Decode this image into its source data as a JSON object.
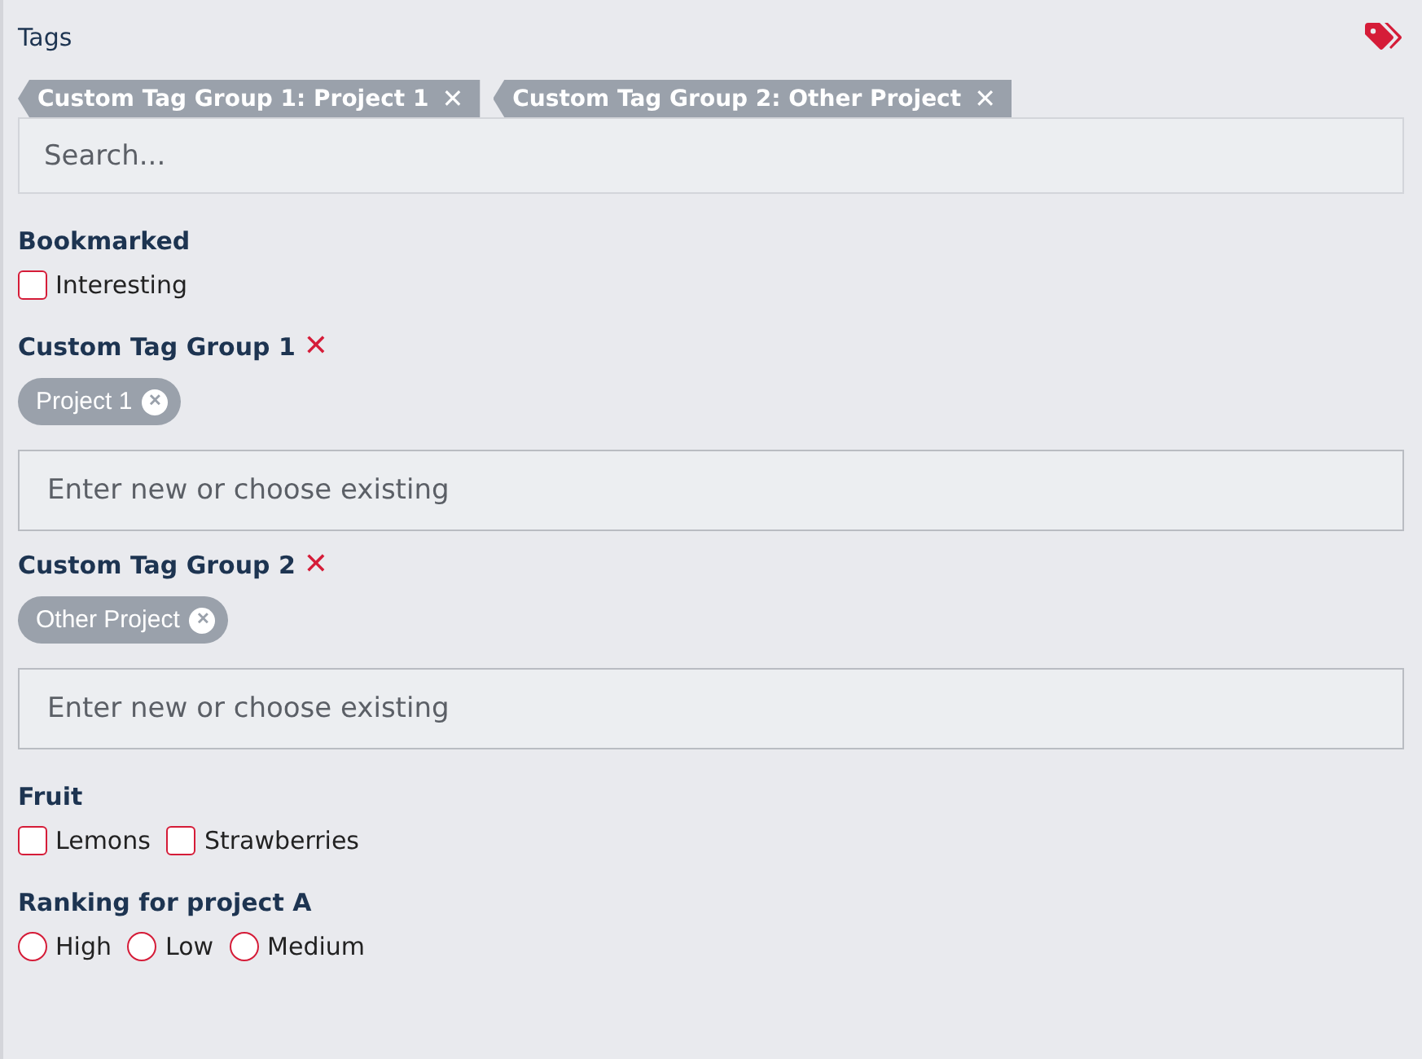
{
  "title": "Tags",
  "active_tags": [
    {
      "label": "Custom Tag Group 1: Project 1",
      "remove": "✕"
    },
    {
      "label": "Custom Tag Group 2: Other Project",
      "remove": "✕"
    }
  ],
  "search": {
    "placeholder": "Search..."
  },
  "sections": [
    {
      "kind": "checkboxes",
      "label": "Bookmarked",
      "options": [
        {
          "label": "Interesting",
          "checked": false
        }
      ]
    },
    {
      "kind": "taggroup",
      "label": "Custom Tag Group 1",
      "remove": "✕",
      "tags": [
        "Project 1"
      ],
      "field": {
        "placeholder": "Enter new or choose existing"
      }
    },
    {
      "kind": "taggroup",
      "label": "Custom Tag Group 2",
      "remove": "✕",
      "tags": [
        "Other Project"
      ],
      "field": {
        "placeholder": "Enter new or choose existing"
      }
    },
    {
      "kind": "checkboxes",
      "label": "Fruit",
      "options": [
        {
          "label": "Lemons",
          "checked": false
        },
        {
          "label": "Strawberries",
          "checked": false
        }
      ]
    },
    {
      "kind": "radios",
      "label": "Ranking for project A",
      "options": [
        {
          "label": "High",
          "selected": false
        },
        {
          "label": "Low",
          "selected": false
        },
        {
          "label": "Medium",
          "selected": false
        }
      ]
    }
  ]
}
